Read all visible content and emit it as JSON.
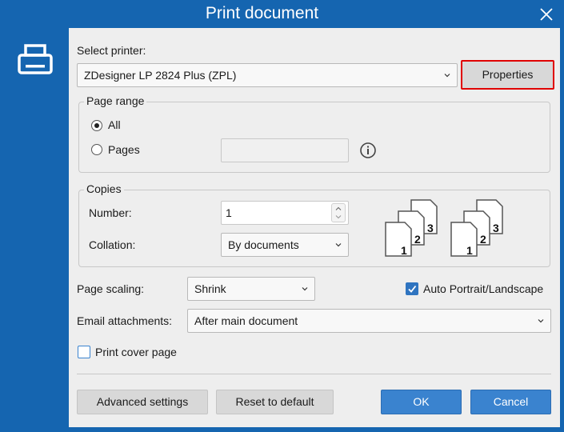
{
  "window": {
    "title": "Print document"
  },
  "printer": {
    "label": "Select printer:",
    "selected": "ZDesigner LP 2824 Plus (ZPL)",
    "properties_label": "Properties"
  },
  "page_range": {
    "title": "Page range",
    "all_label": "All",
    "pages_label": "Pages",
    "pages_value": "",
    "selected": "All"
  },
  "copies": {
    "title": "Copies",
    "number_label": "Number:",
    "number_value": "1",
    "collation_label": "Collation:",
    "collation_value": "By documents"
  },
  "collation_icons": {
    "labels": [
      "1",
      "2",
      "3"
    ]
  },
  "scaling": {
    "label": "Page scaling:",
    "value": "Shrink"
  },
  "auto_orientation": {
    "label": "Auto Portrait/Landscape",
    "checked": true
  },
  "email": {
    "label": "Email attachments:",
    "value": "After main document"
  },
  "cover": {
    "label": "Print cover page",
    "checked": false
  },
  "buttons": {
    "advanced": "Advanced settings",
    "reset": "Reset to default",
    "ok": "OK",
    "cancel": "Cancel"
  },
  "colors": {
    "titlebar": "#1565b0",
    "accent": "#3a83cf",
    "highlight": "#e00000"
  },
  "icons": {
    "close": "close-icon",
    "printer": "printer-icon",
    "info": "info-icon",
    "chevron": "chevron-down-icon"
  }
}
